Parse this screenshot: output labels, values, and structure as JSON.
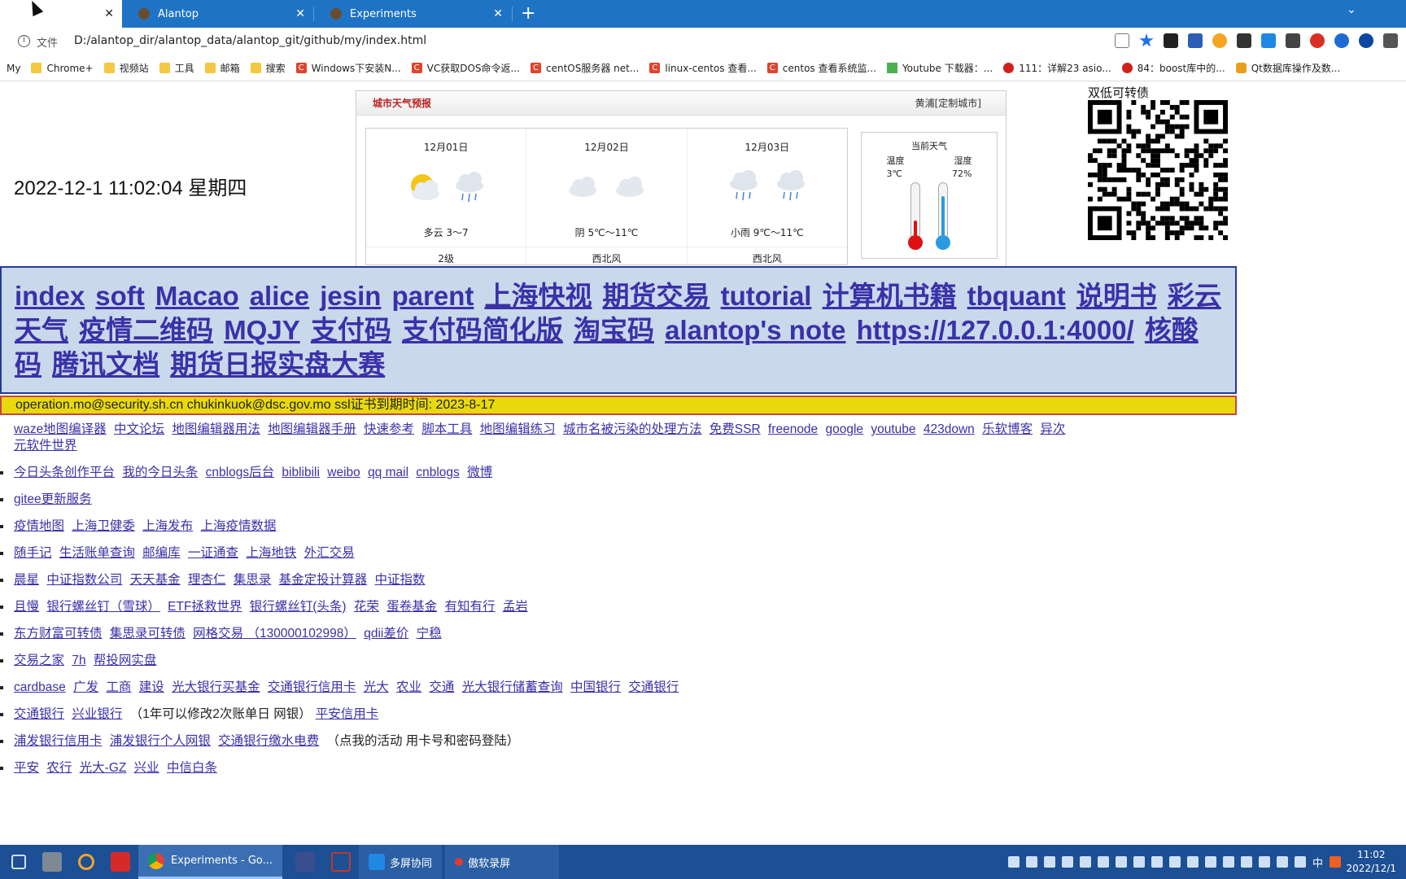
{
  "browser": {
    "tabs": [
      {
        "label": "",
        "active": true
      },
      {
        "label": "Alantop",
        "active": false
      },
      {
        "label": "Experiments",
        "active": false
      }
    ],
    "url_label": "文件",
    "url": "D:/alantop_dir/alantop_data/alantop_git/github/my/index.html",
    "bookmarks": [
      {
        "label": "My",
        "icon": "none"
      },
      {
        "label": "Chrome+",
        "icon": "folder"
      },
      {
        "label": "视频站",
        "icon": "folder"
      },
      {
        "label": "工具",
        "icon": "folder"
      },
      {
        "label": "邮箱",
        "icon": "folder"
      },
      {
        "label": "搜索",
        "icon": "folder"
      },
      {
        "label": "Windows下安装N...",
        "icon": "c"
      },
      {
        "label": "VC获取DOS命令返...",
        "icon": "c"
      },
      {
        "label": "centOS服务器 net...",
        "icon": "c"
      },
      {
        "label": "linux-centos 查看...",
        "icon": "c"
      },
      {
        "label": "centos 查看系统监...",
        "icon": "c"
      },
      {
        "label": "Youtube 下载器：...",
        "icon": "yt"
      },
      {
        "label": "111：详解23 asio...",
        "icon": "red"
      },
      {
        "label": "84：boost库中的...",
        "icon": "red"
      },
      {
        "label": "Qt数据库操作及数...",
        "icon": "qt"
      }
    ]
  },
  "page": {
    "datetime": "2022-12-1 11:02:04 星期四",
    "weather": {
      "title": "城市天气预报",
      "city": "黄浦[定制城市]",
      "days": [
        {
          "date": "12月01日",
          "desc": "多云 3～7",
          "wind": "2级",
          "icon": "sun-cloud"
        },
        {
          "date": "12月02日",
          "desc": "阴 5℃～11℃",
          "wind": "西北风",
          "icon": "overcast"
        },
        {
          "date": "12月03日",
          "desc": "小雨 9℃～11℃",
          "wind": "西北风",
          "icon": "light-rain"
        }
      ],
      "current": {
        "title": "当前天气",
        "temp_label": "温度",
        "humidity_label": "湿度",
        "temp": "3℃",
        "humidity": "72%"
      }
    },
    "qr_label": "双低可转债",
    "nav_links": [
      "index",
      "soft",
      "Macao",
      "alice",
      "jesin",
      "parent",
      "上海快视",
      "期货交易",
      "tutorial",
      "计算机书籍",
      "tbquant",
      "说明书",
      "彩云天气",
      "疫情二维码",
      "MQJY",
      "支付码",
      "支付码简化版",
      "淘宝码",
      "alantop's note",
      "https://127.0.0.1:4000/",
      "核酸码",
      "腾讯文档",
      "期货日报实盘大赛"
    ],
    "notice": "operation.mo@security.sh.cn chukinkuok@dsc.gov.mo ssl证书到期时间: 2023-8-17",
    "link_rows": [
      {
        "links": [
          "waze地图编译器",
          "中文论坛",
          "地图编辑器用法",
          "地图编辑器手册",
          "快速参考",
          "脚本工具",
          "地图编辑练习",
          "城市名被污染的处理方法",
          "免费SSR",
          "freenode",
          "google",
          "youtube",
          "423down",
          "乐软博客",
          "异次元软件世界"
        ],
        "tail": ""
      },
      {
        "links": [
          "今日头条创作平台",
          "我的今日头条",
          "cnblogs后台",
          "biblibili",
          "weibo",
          "qq mail",
          "cnblogs",
          "微博"
        ],
        "tail": ""
      },
      {
        "links": [
          "gitee更新服务"
        ],
        "tail": ""
      },
      {
        "links": [
          "疫情地图",
          "上海卫健委",
          "上海发布",
          "上海疫情数据"
        ],
        "tail": ""
      },
      {
        "links": [
          "随手记",
          "生活账单查询",
          "邮编库",
          "一证通查",
          "上海地铁",
          "外汇交易"
        ],
        "tail": ""
      },
      {
        "links": [
          "晨星",
          "中证指数公司",
          "天天基金",
          "理杏仁",
          "集思录",
          "基金定投计算器",
          "中证指数"
        ],
        "tail": ""
      },
      {
        "links": [
          "且慢",
          "银行螺丝钉（雪球）",
          "ETF拯救世界",
          "银行螺丝钉(头条)",
          "花荣",
          "蛋卷基金",
          "有知有行",
          "孟岩"
        ],
        "tail": ""
      },
      {
        "links": [
          "东方财富可转债",
          "集思录可转债",
          "网格交易 （130000102998）",
          "qdii差价",
          "宁稳"
        ],
        "tail": ""
      },
      {
        "links": [
          "交易之家",
          "7h",
          "帮投网实盘"
        ],
        "tail": ""
      },
      {
        "links": [
          "cardbase",
          "广发",
          "工商",
          "建设",
          "光大银行买基金",
          "交通银行信用卡",
          "光大",
          "农业",
          "交通",
          "光大银行储蓄查询",
          "中国银行",
          "交通银行"
        ],
        "tail": ""
      },
      {
        "links": [
          "交通银行",
          "兴业银行"
        ],
        "tail": "（1年可以修改2次账单日 网银）",
        "after": [
          "平安信用卡"
        ]
      },
      {
        "links": [
          "浦发银行信用卡",
          "浦发银行个人网银",
          "交通银行缴水电费"
        ],
        "tail": "（点我的活动 用卡号和密码登陆）"
      },
      {
        "links": [
          "平安",
          "农行",
          "光大-GZ",
          "兴业",
          "中信白条"
        ],
        "tail": ""
      }
    ]
  },
  "taskbar": {
    "apps": [
      {
        "label": "Experiments - Go...",
        "active": true
      },
      {
        "label": "多屏协同",
        "active": false
      },
      {
        "label": "傲软录屏",
        "active": false
      }
    ],
    "time": "11:02",
    "date": "2022/12/1",
    "ime": "中"
  }
}
